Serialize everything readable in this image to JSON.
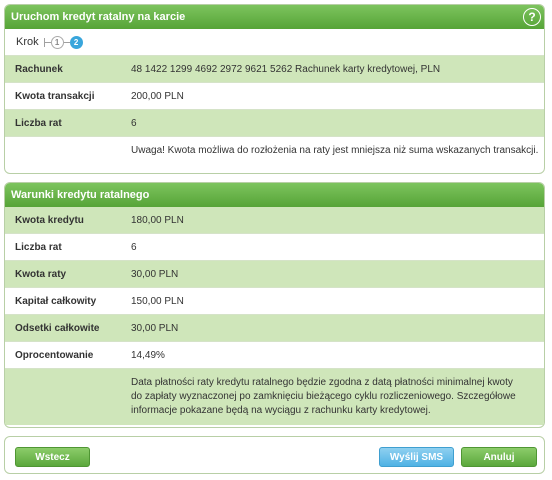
{
  "panel1": {
    "title": "Uruchom kredyt ratalny na karcie",
    "help_label": "?",
    "steps_label": "Krok",
    "steps": [
      "1",
      "2"
    ],
    "rows": [
      {
        "label": "Rachunek",
        "value": "48 1422 1299 4692 2972 9621 5262 Rachunek karty kredytowej, PLN"
      },
      {
        "label": "Kwota transakcji",
        "value": "200,00 PLN"
      },
      {
        "label": "Liczba rat",
        "value": "6"
      }
    ],
    "warning": "Uwaga! Kwota możliwa do rozłożenia na raty jest mniejsza niż suma wskazanych transakcji."
  },
  "panel2": {
    "title": "Warunki kredytu ratalnego",
    "rows": [
      {
        "label": "Kwota kredytu",
        "value": "180,00 PLN"
      },
      {
        "label": "Liczba rat",
        "value": "6"
      },
      {
        "label": "Kwota raty",
        "value": "30,00 PLN"
      },
      {
        "label": "Kapitał całkowity",
        "value": "150,00 PLN"
      },
      {
        "label": "Odsetki całkowite",
        "value": "30,00 PLN"
      },
      {
        "label": "Oprocentowanie",
        "value": "14,49%"
      }
    ],
    "note": "Data płatności raty kredytu ratalnego będzie zgodna z datą płatności minimalnej kwoty do zapłaty wyznaczonej po zamknięciu bieżącego cyklu rozliczeniowego. Szczegółowe informacje pokazane będą na wyciągu z rachunku karty kredytowej."
  },
  "footer": {
    "back_label": "Wstecz",
    "sms_label": "Wyślij SMS",
    "cancel_label": "Anuluj"
  },
  "colors": {
    "header_green": "#56a437",
    "row_green": "#cfe6ba",
    "step_active": "#39a6dc",
    "sms_blue": "#4fb2e4"
  }
}
